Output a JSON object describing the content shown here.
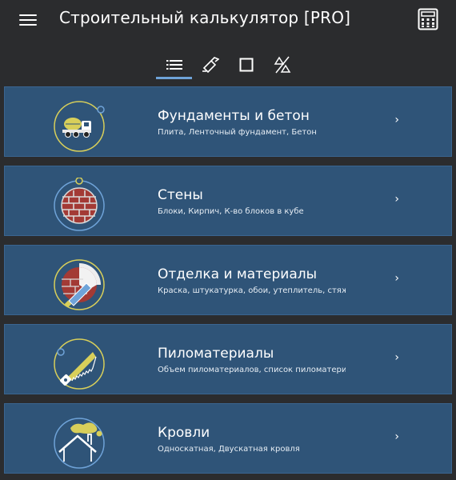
{
  "app": {
    "title": "Строительный калькулятор [PRO]"
  },
  "tabs": [
    {
      "name": "list",
      "active": true
    },
    {
      "name": "trowel",
      "active": false
    },
    {
      "name": "square",
      "active": false
    },
    {
      "name": "triangles",
      "active": false
    }
  ],
  "categories": [
    {
      "title": "Фундаменты и бетон",
      "subtitle": "Плита, Ленточный фундамент, Бетон",
      "icon": "concrete-truck-icon"
    },
    {
      "title": "Стены",
      "subtitle": "Блоки, Кирпич, К-во блоков в кубе",
      "icon": "brick-wall-icon"
    },
    {
      "title": "Отделка и материалы",
      "subtitle": "Краска, штукатурка, обои, утеплитель, стяжка",
      "icon": "trowel-wall-icon"
    },
    {
      "title": "Пиломатериалы",
      "subtitle": "Объем пиломатериалов, список пиломатериалов",
      "icon": "saw-icon"
    },
    {
      "title": "Кровли",
      "subtitle": "Односкатная, Двускатная кровля",
      "icon": "roof-icon"
    }
  ],
  "chevron": "›",
  "colors": {
    "background": "#2b2c2e",
    "card": "#2f5478",
    "accent_yellow": "#d8cf5a",
    "accent_blue": "#6fa3d8"
  }
}
